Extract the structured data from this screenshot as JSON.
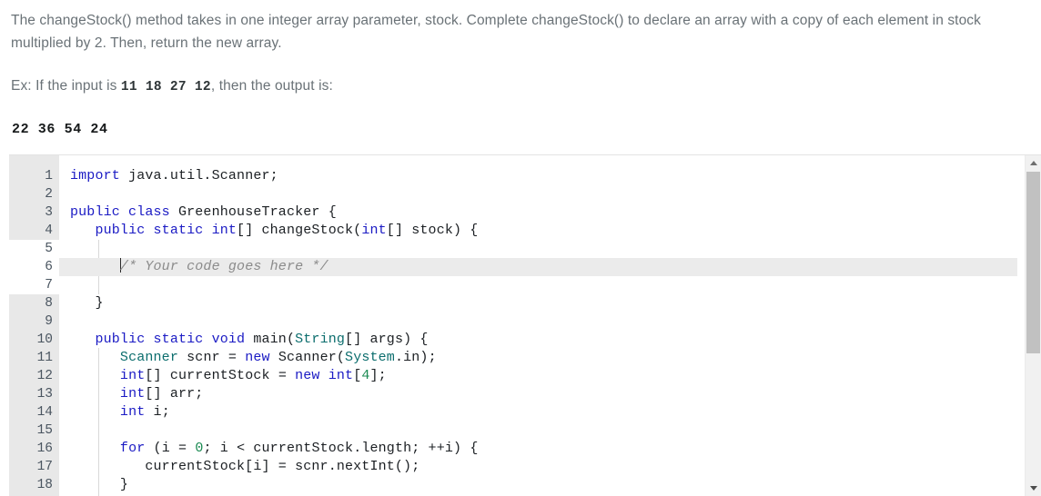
{
  "prompt": {
    "intro": "The changeStock() method takes in one integer array parameter, stock. Complete changeStock() to declare an array with a copy of each element in stock multiplied by 2. Then, return the new array.",
    "example_prefix": "Ex: If the input is ",
    "example_input": "11  18  27  12",
    "example_suffix": ", then the output is:",
    "example_output": "22  36  54  24"
  },
  "editor": {
    "language": "java",
    "highlighted_line": 6,
    "placeholder_comment": "/* Your code goes here */",
    "lines": [
      {
        "n": "1",
        "text": "import java.util.Scanner;"
      },
      {
        "n": "2",
        "text": ""
      },
      {
        "n": "3",
        "text": "public class GreenhouseTracker {"
      },
      {
        "n": "4",
        "text": "   public static int[] changeStock(int[] stock) {"
      },
      {
        "n": "5",
        "text": ""
      },
      {
        "n": "6",
        "text": "      /* Your code goes here */"
      },
      {
        "n": "7",
        "text": ""
      },
      {
        "n": "8",
        "text": "   }"
      },
      {
        "n": "9",
        "text": ""
      },
      {
        "n": "10",
        "text": "   public static void main(String[] args) {"
      },
      {
        "n": "11",
        "text": "      Scanner scnr = new Scanner(System.in);"
      },
      {
        "n": "12",
        "text": "      int[] currentStock = new int[4];"
      },
      {
        "n": "13",
        "text": "      int[] arr;"
      },
      {
        "n": "14",
        "text": "      int i;"
      },
      {
        "n": "15",
        "text": ""
      },
      {
        "n": "16",
        "text": "      for (i = 0; i < currentStock.length; ++i) {"
      },
      {
        "n": "17",
        "text": "         currentStock[i] = scnr.nextInt();"
      },
      {
        "n": "18",
        "text": "      }"
      }
    ]
  },
  "scrollbar": {
    "up_arrow": "scroll-up",
    "down_arrow": "scroll-down"
  },
  "colors": {
    "keyword": "#1a1ac4",
    "type": "#0b6d6d",
    "number": "#1a8a52",
    "comment": "#8b8b8b",
    "gutter_bg": "#e8e8e8",
    "line_highlight": "#ebebeb",
    "scrollbar_thumb": "#c1c1c1",
    "prompt_text": "#6a7277"
  }
}
